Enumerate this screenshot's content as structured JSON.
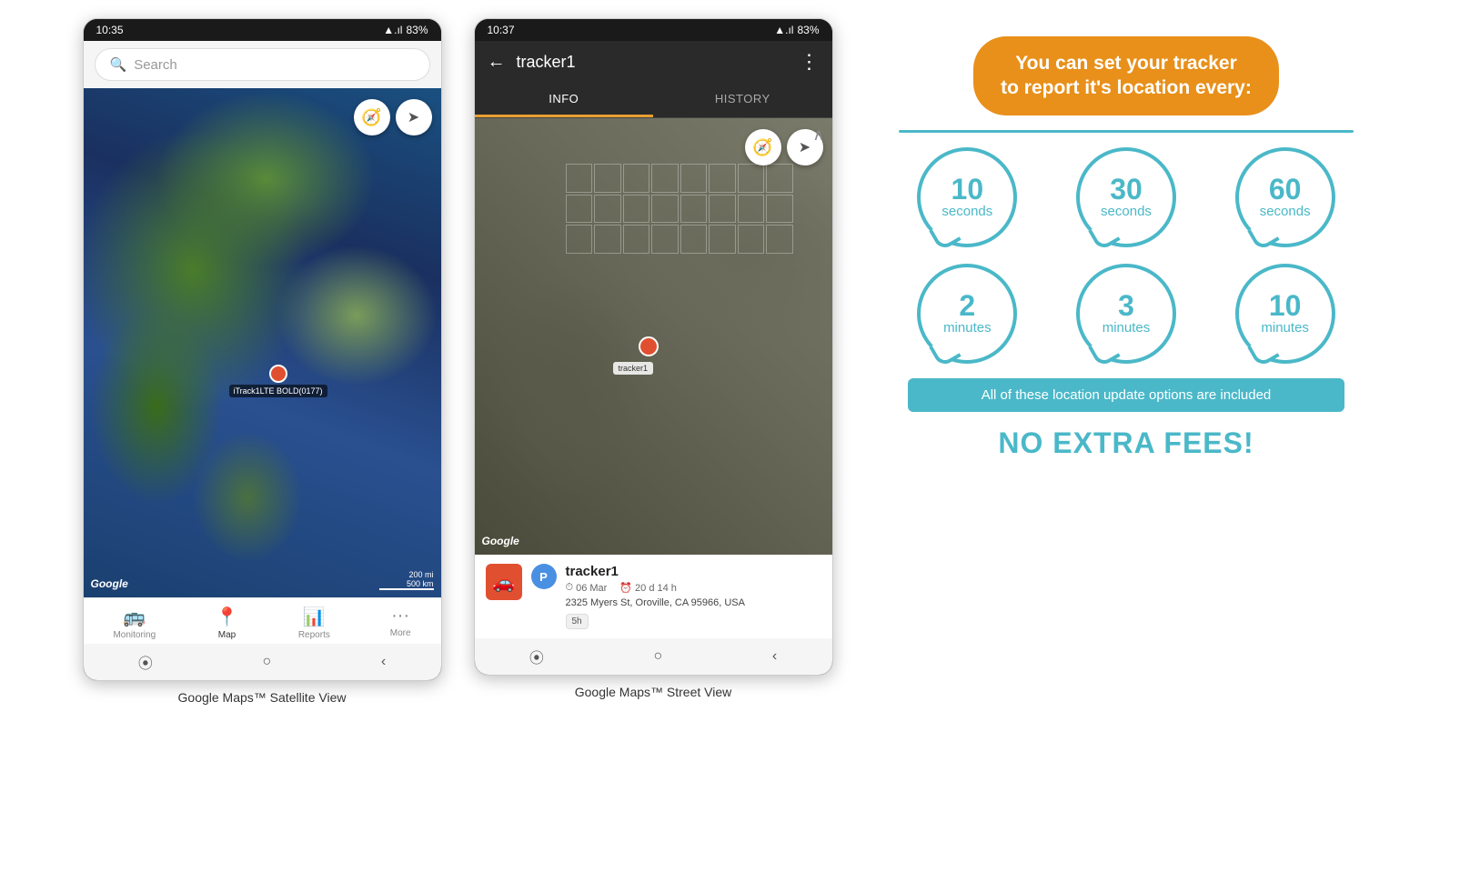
{
  "phone1": {
    "status": {
      "time": "10:35",
      "signal": "▲.ıl",
      "wifi": "▲",
      "battery": "83%"
    },
    "search": {
      "placeholder": "Search"
    },
    "tracker": {
      "label": "iTrack1LTE BOLD(0177)",
      "car_emoji": "🚗"
    },
    "nav_items": [
      {
        "label": "Monitoring",
        "icon": "🚌",
        "active": false
      },
      {
        "label": "Map",
        "icon": "📍",
        "active": true
      },
      {
        "label": "Reports",
        "icon": "📊",
        "active": false
      },
      {
        "label": "More",
        "icon": "···",
        "active": false
      }
    ],
    "google_label": "Google",
    "scale_200mi": "200 mi",
    "scale_500km": "500 km",
    "caption": "Google Maps™ Satellite View"
  },
  "phone2": {
    "status": {
      "time": "10:37",
      "battery": "83%"
    },
    "header": {
      "title": "tracker1",
      "back": "←",
      "more": "⋮"
    },
    "tabs": [
      {
        "label": "INFO",
        "active": true
      },
      {
        "label": "HISTORY",
        "active": false
      }
    ],
    "tracker_info": {
      "name": "tracker1",
      "date": "06 Mar",
      "duration": "20 d 14 h",
      "address": "2325 Myers St, Oroville, CA 95966, USA",
      "badge": "5h"
    },
    "google_label": "Google",
    "tracker_label": "tracker1",
    "caption": "Google Maps™ Street View"
  },
  "info_panel": {
    "header_line1": "You can set your tracker",
    "header_line2": "to report it's location every:",
    "circles": [
      {
        "number": "10",
        "unit": "seconds"
      },
      {
        "number": "30",
        "unit": "seconds"
      },
      {
        "number": "60",
        "unit": "seconds"
      },
      {
        "number": "2",
        "unit": "minutes"
      },
      {
        "number": "3",
        "unit": "minutes"
      },
      {
        "number": "10",
        "unit": "minutes"
      }
    ],
    "banner_text": "All of these location update options are included",
    "no_fees_text": "NO EXTRA FEES!"
  }
}
